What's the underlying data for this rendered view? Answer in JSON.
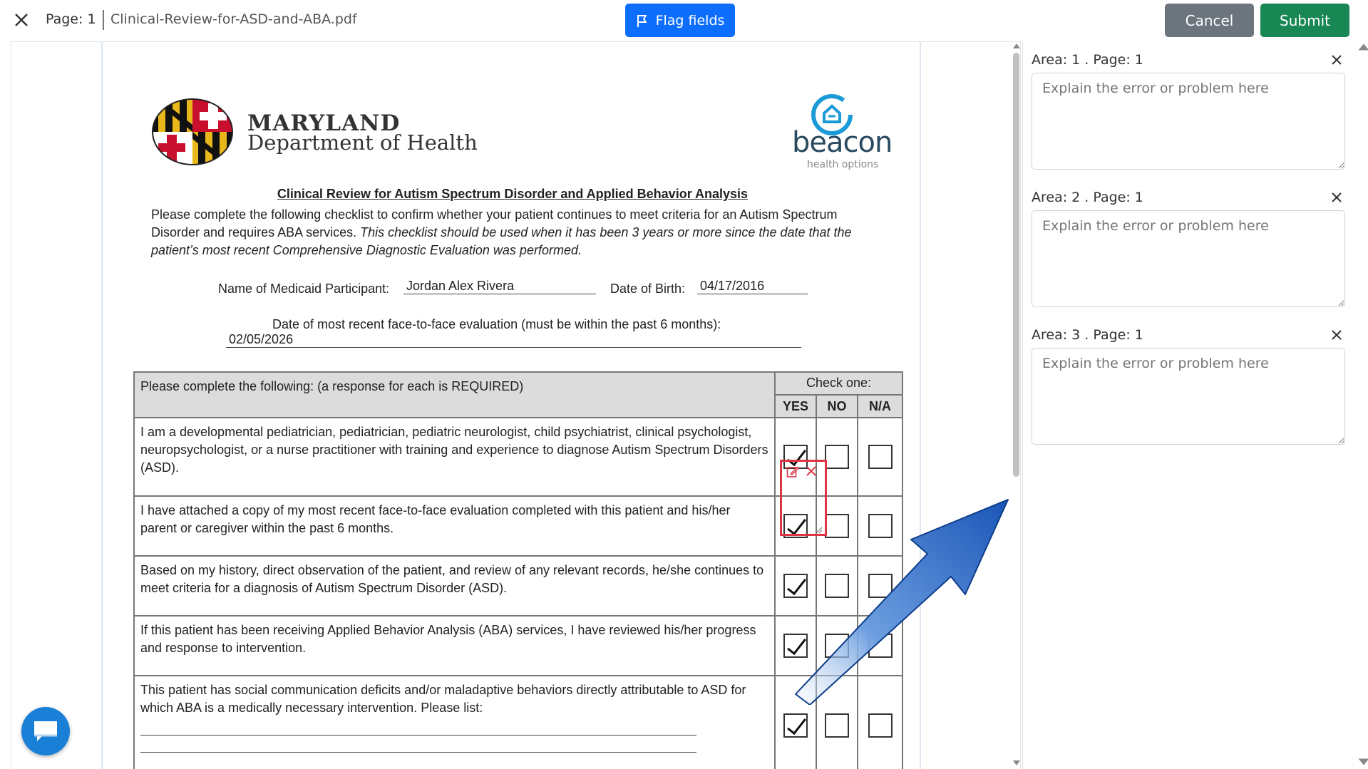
{
  "topbar": {
    "page_label": "Page: 1",
    "file_name": "Clinical-Review-for-ASD-and-ABA.pdf",
    "flag_label": "Flag fields",
    "cancel_label": "Cancel",
    "submit_label": "Submit"
  },
  "document": {
    "org_line1": "MARYLAND",
    "org_line2": "Department of Health",
    "beacon_word": "beacon",
    "beacon_sub": "health options",
    "heading": "Clinical Review for Autism Spectrum Disorder and Applied Behavior Analysis",
    "intro_plain": "Please complete the following checklist to confirm whether your patient continues to meet criteria for an Autism Spectrum Disorder and requires ABA services. ",
    "intro_italic": "This checklist should be used when it has been 3 years or more since the date that the patient’s most recent Comprehensive Diagnostic Evaluation was performed.",
    "participant_label": "Name of Medicaid Participant:",
    "participant_value": "Jordan Alex Rivera",
    "dob_label": "Date of Birth:",
    "dob_value": "04/17/2016",
    "eval_label": "Date of most recent face-to-face evaluation (must be within the past 6 months):",
    "eval_value": "02/05/2026",
    "table": {
      "instruction": "Please complete the following: (a response for each is REQUIRED)",
      "check_one": "Check one:",
      "col_yes": "YES",
      "col_no": "NO",
      "col_na": "N/A",
      "rows": [
        {
          "text": "I am a developmental pediatrician, pediatrician, pediatric neurologist, child psychiatrist, clinical psychologist, neuropsychologist, or a nurse practitioner with training and experience to diagnose Autism Spectrum Disorders (ASD).",
          "yes": true
        },
        {
          "text": "I have attached a copy of my most recent face-to-face evaluation completed with this patient and his/her parent or caregiver within the past 6 months.",
          "yes": true
        },
        {
          "text": "Based on my history, direct observation of the patient, and review of any relevant records, he/she continues to meet criteria for a diagnosis of Autism Spectrum Disorder (ASD).",
          "yes": true
        },
        {
          "text": "If this patient has been receiving Applied Behavior Analysis (ABA) services, I have reviewed his/her progress and response to intervention.",
          "yes": true
        },
        {
          "text": "This patient has social communication deficits and/or maladaptive behaviors directly attributable to ASD for which ABA is a medically necessary intervention.  Please list:",
          "yes": true
        }
      ]
    }
  },
  "side_panel": {
    "areas": [
      {
        "title": "Area: 1 . Page: 1",
        "placeholder": "Explain the error or problem here"
      },
      {
        "title": "Area: 2 . Page: 1",
        "placeholder": "Explain the error or problem here"
      },
      {
        "title": "Area: 3 . Page: 1",
        "placeholder": "Explain the error or problem here"
      }
    ]
  },
  "colors": {
    "primary": "#0d6efd",
    "cancel": "#6c757d",
    "submit": "#198754",
    "flag_outline": "#dc3545",
    "chat": "#1a7fd6"
  },
  "icons": [
    "close-icon",
    "flag-icon",
    "edit-icon",
    "delete-icon",
    "resize-handle-icon",
    "chat-icon",
    "arrow-annotation"
  ]
}
